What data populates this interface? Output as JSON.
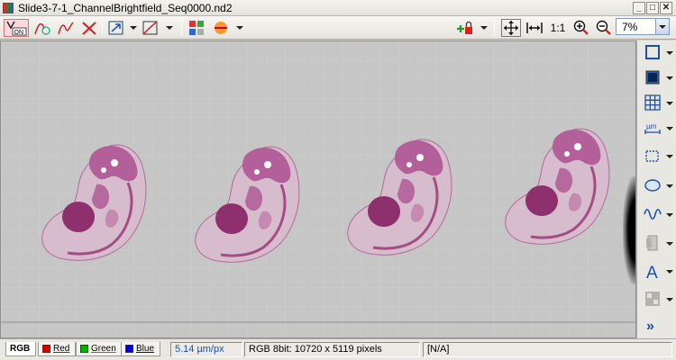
{
  "window": {
    "title": "Slide3-7-1_ChannelBrightfield_Seq0000.nd2",
    "icon_colors": [
      "#d32f2f",
      "#2e7d32",
      "#1565c0"
    ]
  },
  "toolbar": {
    "on_label": "ON",
    "one_to_one_label": "1:1",
    "zoom_value": "7%"
  },
  "viewport": {
    "background": "#c6c6c6",
    "tissue_color": "#a24d84"
  },
  "right_tools": [
    {
      "name": "rectangle-select-icon"
    },
    {
      "name": "overlay-square-icon"
    },
    {
      "name": "grid-icon"
    },
    {
      "name": "scale-bar-um-icon",
      "label": "µm"
    },
    {
      "name": "crop-icon"
    },
    {
      "name": "ellipse-roi-icon"
    },
    {
      "name": "wave-profile-icon"
    },
    {
      "name": "layers-icon"
    },
    {
      "name": "text-annotation-icon",
      "label": "A"
    },
    {
      "name": "tiles-icon"
    },
    {
      "name": "expand-more-icon",
      "label": "»"
    }
  ],
  "channels": [
    {
      "label": "RGB",
      "color": "#ffffff",
      "active": true
    },
    {
      "label": "Red",
      "color": "#d40000",
      "active": false
    },
    {
      "label": "Green",
      "color": "#00b400",
      "active": false
    },
    {
      "label": "Blue",
      "color": "#0000d0",
      "active": false
    }
  ],
  "status": {
    "calibration": "5.14 µm/px",
    "image_info": "RGB 8bit: 10720 x 5119 pixels",
    "value": "[N/A]"
  }
}
